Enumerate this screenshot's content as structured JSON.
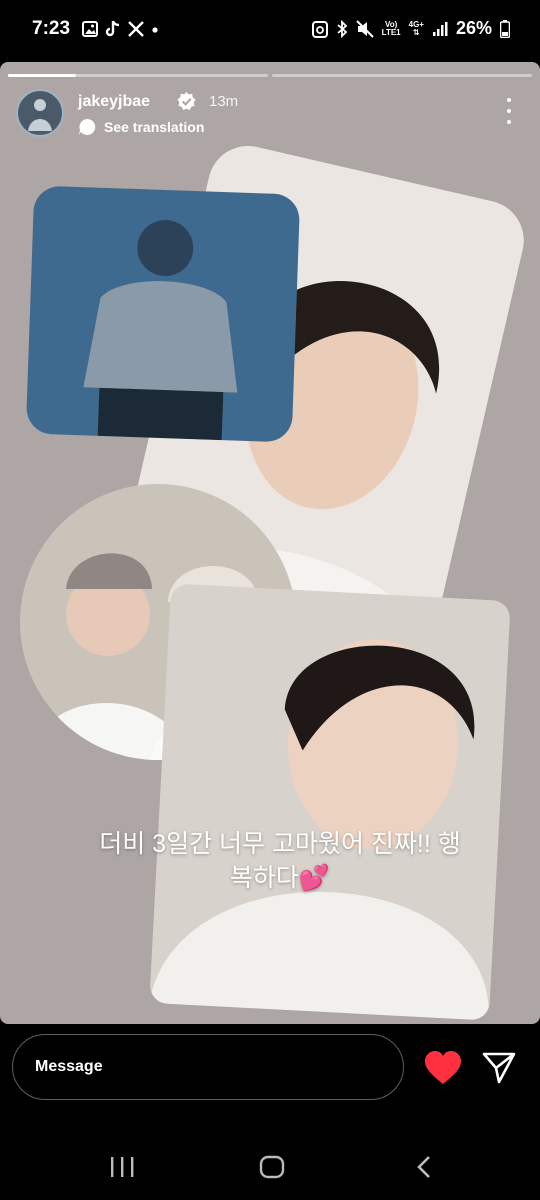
{
  "status_bar": {
    "time": "7:23",
    "left_icons": [
      "gallery-icon",
      "tiktok-icon",
      "x-icon",
      "dot-icon"
    ],
    "network_top": "Vo)",
    "network_bottom": "LTE1",
    "data_top": "4G+",
    "battery_percent": "26%",
    "right_icons": [
      "data-saver-icon",
      "bluetooth-icon",
      "mute-icon",
      "signal-icon",
      "battery-icon"
    ]
  },
  "story": {
    "progress_segments": 2,
    "active_segment": 1,
    "username": "jakeyjbae",
    "verified": true,
    "time_ago": "13m",
    "translate_label": "See translation",
    "text_line1": "더비 3일간 너무 고마웠어 진짜!! 행",
    "text_line2": "복하다💕",
    "background_color": "#ada6a4"
  },
  "composer": {
    "placeholder": "Message"
  },
  "actions": {
    "like_color": "#ff3040",
    "icons": [
      "heart-icon",
      "send-icon"
    ]
  },
  "navigation": {
    "icons": [
      "recents-icon",
      "home-icon",
      "back-icon"
    ]
  }
}
